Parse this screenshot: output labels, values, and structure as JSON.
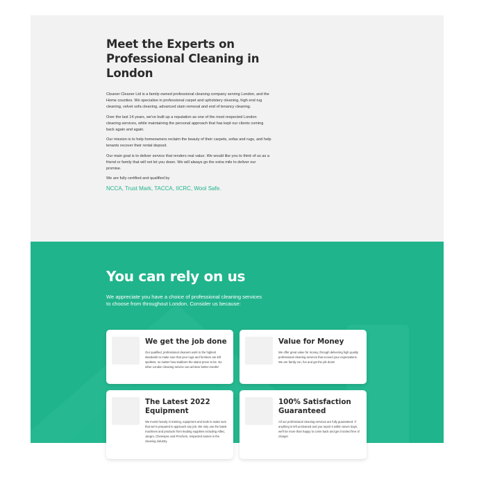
{
  "experts": {
    "title": "Meet the Experts on Professional Cleaning in London",
    "paragraphs": [
      "Cleaner Cleaner Ltd is a family-owned professional cleaning company serving London, and the Home counties. We specialise in professional carpet and upholstery cleaning, high end rug cleaning, velvet sofa cleaning, advanced stain removal and end of tenancy cleaning.",
      "Over the last 14 years, we've built up a reputation as one of the most respected London cleaning services, while maintaining the personal approach that has kept our clients coming back again and again.",
      "Our mission is to help homeowners reclaim the beauty of their carpets, sofas and rugs, and help tenants recover their rental deposit.",
      "Our main goal is to deliver service that renders real value. We would like you to think of us as a friend or family that will not let you down. We will always go the extra mile to deliver our promise.",
      "We are fully certified and qualified by"
    ],
    "certifications": "NCCA, Trust Mark,  TACCA, IICRC, Wool Safe."
  },
  "rely": {
    "title": "You can rely on us",
    "subtitle": "We appreciate you have a choice of professional cleaning services to choose from throughout London. Consider us because:",
    "cards": [
      {
        "title": "We get the job done",
        "text": "Our qualified, professional cleaners work to the highest standards to make sure that your rugs and furniture are left spotless, no matter how stubborn the stains prove to be. No other London cleaning service can achieve better results!"
      },
      {
        "title": "Value for Money",
        "text": "We offer great value for money, through delivering high quality professional cleaning services that exceed your expectations. We are family run, fun and get the job done!"
      },
      {
        "title": "The Latest 2022 Equipment",
        "text": "We invest heavily in training, equipment and tools to make sure that we're prepared to approach any job. We only use the latest machines and products from leading suppliers including Alltec, Jangro, Chemspec and Prochem, respected names in the cleaning industry."
      },
      {
        "title": "100% Satisfaction Guaranteed",
        "text": "All our professional cleaning services are fully guaranteed. If anything is left uncleaned and you report it within seven days, we'll be more than happy to come back and get it sorted free of charge!"
      }
    ]
  },
  "colors": {
    "accent": "#20b48c",
    "panel": "#f2f2f2"
  }
}
